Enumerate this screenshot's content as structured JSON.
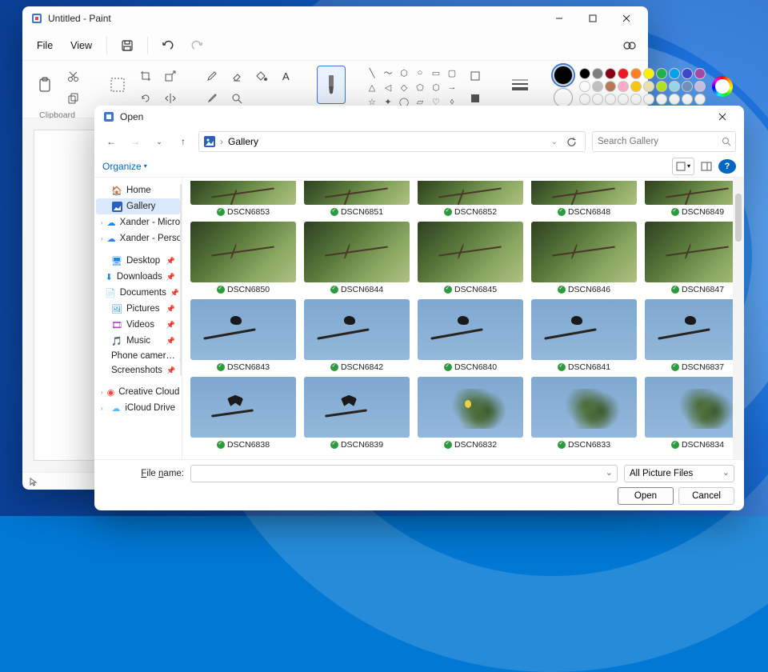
{
  "paint": {
    "title": "Untitled - Paint",
    "menu": {
      "file": "File",
      "view": "View"
    },
    "ribbon": {
      "clipboard_label": "Clipboard"
    },
    "palette": {
      "primary": "#000000",
      "secondary": "#ffffff",
      "colors_row1": [
        "#000000",
        "#7f7f7f",
        "#880015",
        "#ed1c24",
        "#ff7f27",
        "#fff200",
        "#22b14c",
        "#00a2e8",
        "#3f48cc",
        "#a349a4"
      ],
      "colors_row2": [
        "#ffffff",
        "#c3c3c3",
        "#b97a57",
        "#ffaec9",
        "#ffc90e",
        "#efe4b0",
        "#b5e61d",
        "#99d9ea",
        "#7092be",
        "#c8bfe7"
      ],
      "colors_row3_empty": true
    }
  },
  "open_dialog": {
    "title": "Open",
    "breadcrumb": "Gallery",
    "search_placeholder": "Search Gallery",
    "organize_label": "Organize",
    "nav": {
      "home": "Home",
      "gallery": "Gallery",
      "xander_micros": "Xander - Micros…",
      "xander_person": "Xander - Person…",
      "desktop": "Desktop",
      "downloads": "Downloads",
      "documents": "Documents",
      "pictures": "Pictures",
      "videos": "Videos",
      "music": "Music",
      "phone_camera": "Phone camer…",
      "screenshots": "Screenshots",
      "creative_cloud": "Creative Cloud F…",
      "icloud_drive": "iCloud Drive"
    },
    "items": [
      {
        "name": "DSCN6853",
        "art": "forest forest-branch",
        "partial": true
      },
      {
        "name": "DSCN6851",
        "art": "forest forest-branch",
        "partial": true
      },
      {
        "name": "DSCN6852",
        "art": "forest forest-branch",
        "partial": true
      },
      {
        "name": "DSCN6848",
        "art": "forest forest-branch",
        "partial": true
      },
      {
        "name": "DSCN6849",
        "art": "forest forest-branch",
        "partial": true
      },
      {
        "name": "DSCN6850",
        "art": "forest forest-branch forest-bird"
      },
      {
        "name": "DSCN6844",
        "art": "forest forest-branch forest-bird"
      },
      {
        "name": "DSCN6845",
        "art": "forest forest-branch forest-bird"
      },
      {
        "name": "DSCN6846",
        "art": "forest forest-branch forest-bird"
      },
      {
        "name": "DSCN6847",
        "art": "forest forest-branch forest-bird"
      },
      {
        "name": "DSCN6843",
        "art": "sky sky-crow"
      },
      {
        "name": "DSCN6842",
        "art": "sky sky-crow"
      },
      {
        "name": "DSCN6840",
        "art": "sky sky-crow"
      },
      {
        "name": "DSCN6841",
        "art": "sky sky-crow"
      },
      {
        "name": "DSCN6837",
        "art": "sky sky-crow"
      },
      {
        "name": "DSCN6838",
        "art": "sky sky-wings"
      },
      {
        "name": "DSCN6839",
        "art": "sky sky-wings"
      },
      {
        "name": "DSCN6832",
        "art": "tree tree-yellow"
      },
      {
        "name": "DSCN6833",
        "art": "tree"
      },
      {
        "name": "DSCN6834",
        "art": "tree"
      }
    ],
    "footer": {
      "filename_label": "File name:",
      "filename_value": "",
      "filter": "All Picture Files",
      "open_btn": "Open",
      "cancel_btn": "Cancel"
    }
  }
}
